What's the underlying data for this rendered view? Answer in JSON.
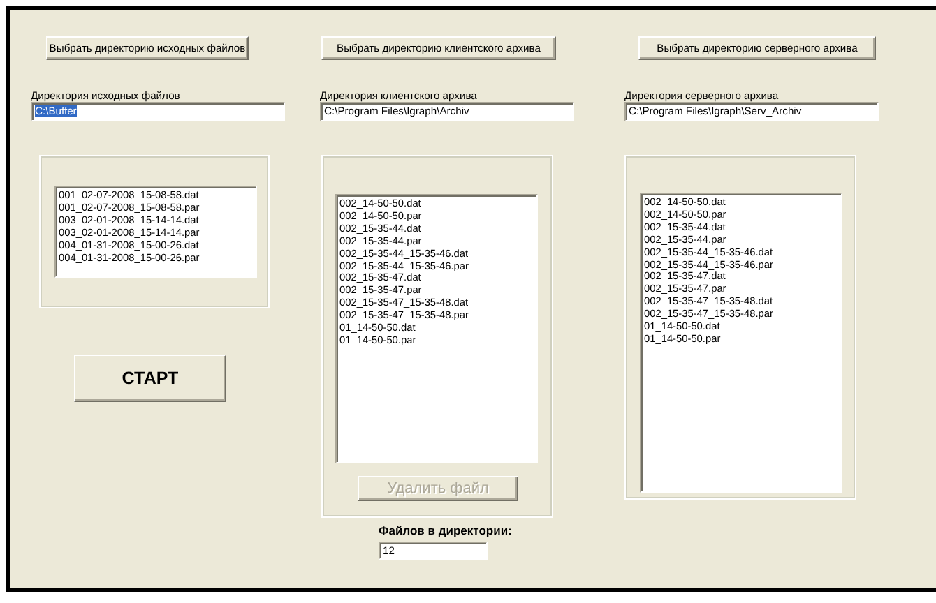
{
  "columns": [
    {
      "button": "Выбрать директорию исходных файлов",
      "field_label": "Директория исходных файлов",
      "path": "C:\\Buffer",
      "path_selected": true,
      "files": [
        "001_02-07-2008_15-08-58.dat",
        "001_02-07-2008_15-08-58.par",
        "003_02-01-2008_15-14-14.dat",
        "003_02-01-2008_15-14-14.par",
        "004_01-31-2008_15-00-26.dat",
        "004_01-31-2008_15-00-26.par"
      ]
    },
    {
      "button": "Выбрать директорию клиентского архива",
      "field_label": "Директория  клиентского архива",
      "path": "C:\\Program Files\\Igraph\\Archiv",
      "path_selected": false,
      "files": [
        "002_14-50-50.dat",
        "002_14-50-50.par",
        "002_15-35-44.dat",
        "002_15-35-44.par",
        "002_15-35-44_15-35-46.dat",
        "002_15-35-44_15-35-46.par",
        "002_15-35-47.dat",
        "002_15-35-47.par",
        "002_15-35-47_15-35-48.dat",
        "002_15-35-47_15-35-48.par",
        "01_14-50-50.dat",
        "01_14-50-50.par"
      ]
    },
    {
      "button": "Выбрать директорию серверного архива",
      "field_label": "Директория серверного архива",
      "path": "C:\\Program Files\\Igraph\\Serv_Archiv",
      "path_selected": false,
      "files": [
        "002_14-50-50.dat",
        "002_14-50-50.par",
        "002_15-35-44.dat",
        "002_15-35-44.par",
        "002_15-35-44_15-35-46.dat",
        "002_15-35-44_15-35-46.par",
        "002_15-35-47.dat",
        "002_15-35-47.par",
        "002_15-35-47_15-35-48.dat",
        "002_15-35-47_15-35-48.par",
        "01_14-50-50.dat",
        "01_14-50-50.par"
      ]
    }
  ],
  "start_button": {
    "label": "СТАРТ"
  },
  "delete_button": {
    "label": "Удалить файл",
    "disabled": true
  },
  "file_count": {
    "label": "Файлов в директории:",
    "value": "12"
  }
}
